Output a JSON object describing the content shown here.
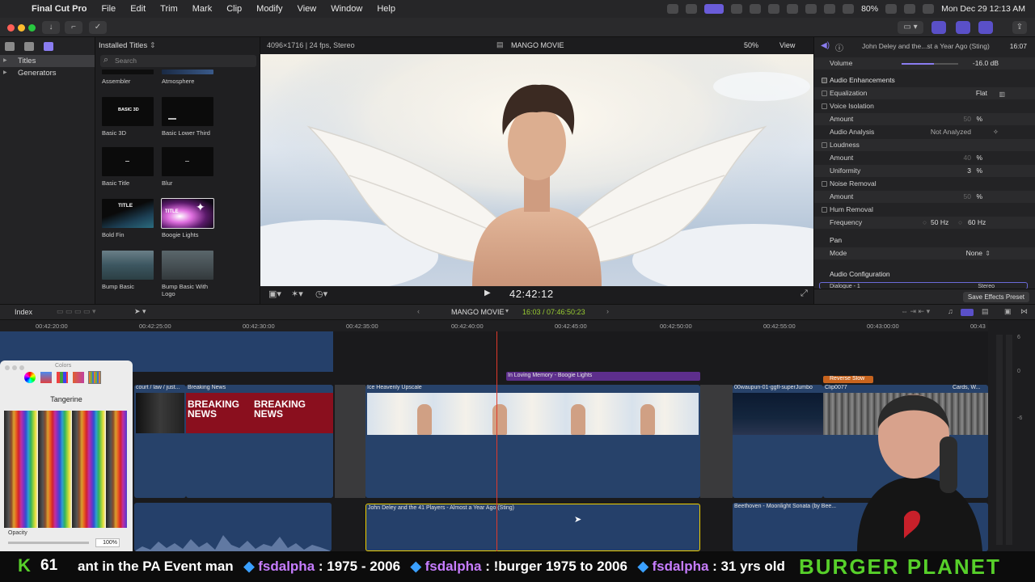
{
  "menubar": {
    "app_name": "Final Cut Pro",
    "menus": [
      "File",
      "Edit",
      "Trim",
      "Mark",
      "Clip",
      "Modify",
      "View",
      "Window",
      "Help"
    ],
    "battery": "80%",
    "datetime": "Mon Dec 29  12:13 AM"
  },
  "sidebar": {
    "items": [
      {
        "label": "Titles",
        "selected": true
      },
      {
        "label": "Generators",
        "selected": false
      }
    ]
  },
  "browser": {
    "header": "Installed Titles",
    "search_placeholder": "Search",
    "tiles": [
      {
        "label": "Assembler"
      },
      {
        "label": "Atmosphere"
      },
      {
        "label": "Basic 3D",
        "thumb_text": "BASIC 3D"
      },
      {
        "label": "Basic Lower Third"
      },
      {
        "label": "Basic Title"
      },
      {
        "label": "Blur"
      },
      {
        "label": "Bold Fin",
        "thumb_text": "TITLE"
      },
      {
        "label": "Boogie Lights",
        "thumb_text": "TITLE",
        "selected": true
      },
      {
        "label": "Bump Basic"
      },
      {
        "label": "Bump Basic With Logo"
      }
    ]
  },
  "viewer": {
    "format": "4096×1716 | 24 fps, Stereo",
    "project_title": "MANGO MOVIE",
    "zoom": "50%",
    "view_label": "View",
    "timecode": "42:42:12"
  },
  "inspector": {
    "clip_name": "John Deley and the...st a Year Ago (Sting)",
    "duration": "16:07",
    "volume_label": "Volume",
    "volume_value": "-16.0  dB",
    "audio_enhancements": "Audio Enhancements",
    "equalization_label": "Equalization",
    "equalization_value": "Flat",
    "voice_isolation": "Voice Isolation",
    "amount_label": "Amount",
    "amount_value_1": "50",
    "percent": "%",
    "audio_analysis_label": "Audio Analysis",
    "audio_analysis_value": "Not Analyzed",
    "loudness": "Loudness",
    "amount_value_2": "40",
    "uniformity_label": "Uniformity",
    "uniformity_value": "3",
    "noise_removal": "Noise Removal",
    "amount_value_3": "50",
    "hum_removal": "Hum Removal",
    "frequency_label": "Frequency",
    "freq_50": "50 Hz",
    "freq_60": "60 Hz",
    "pan": "Pan",
    "mode_label": "Mode",
    "mode_value": "None",
    "audio_config": "Audio Configuration",
    "dialogue": "Dialogue - 1",
    "stereo": "Stereo",
    "save_preset": "Save Effects Preset"
  },
  "timeline": {
    "index_label": "Index",
    "project": "MANGO MOVIE",
    "duration": "16:03 / 07:46:50:23",
    "ruler": [
      "00:42:20:00",
      "00:42:25:00",
      "00:42:30:00",
      "00:42:35:00",
      "00:42:40:00",
      "00:42:45:00",
      "00:42:50:00",
      "00:42:55:00",
      "00:43:00:00",
      "00:43"
    ],
    "clips": {
      "title_clip": "In Loving Memory - Boogie Lights",
      "clip_court": "court / law / just...",
      "clip_breaking": "Breaking News",
      "breaking_text": "BREAKING NEWS",
      "clip_heavenly": "Ice Heavenly Upscale",
      "clip_night": "00waupun-01-ggfl-superJumbo",
      "clip_0077": "Clip0077",
      "clip_cards": "Cards, W...",
      "reverse_slow": "Reverse Slow",
      "audio_main": "John Deley and the 41 Players - Almost a Year Ago (Sting)",
      "audio_beethoven": "Beethoven - Moonlight Sonata (by Bee..."
    },
    "meter_labels": [
      "6",
      "0",
      "-6"
    ]
  },
  "colors_panel": {
    "title": "Colors",
    "color_name": "Tangerine",
    "opacity_label": "Opacity",
    "opacity_value": "100%"
  },
  "stream": {
    "k_letter": "K",
    "k_count": "61",
    "ticker_1": "ant in the PA Event man",
    "user_1": "fsdalpha",
    "msg_1": ": 1975 - 2006",
    "user_2": "fsdalpha",
    "msg_2": ": !burger 1975 to 2006",
    "user_3": "fsdalpha",
    "msg_3": ": 31 yrs old",
    "brand": "BURGER PLANET"
  }
}
